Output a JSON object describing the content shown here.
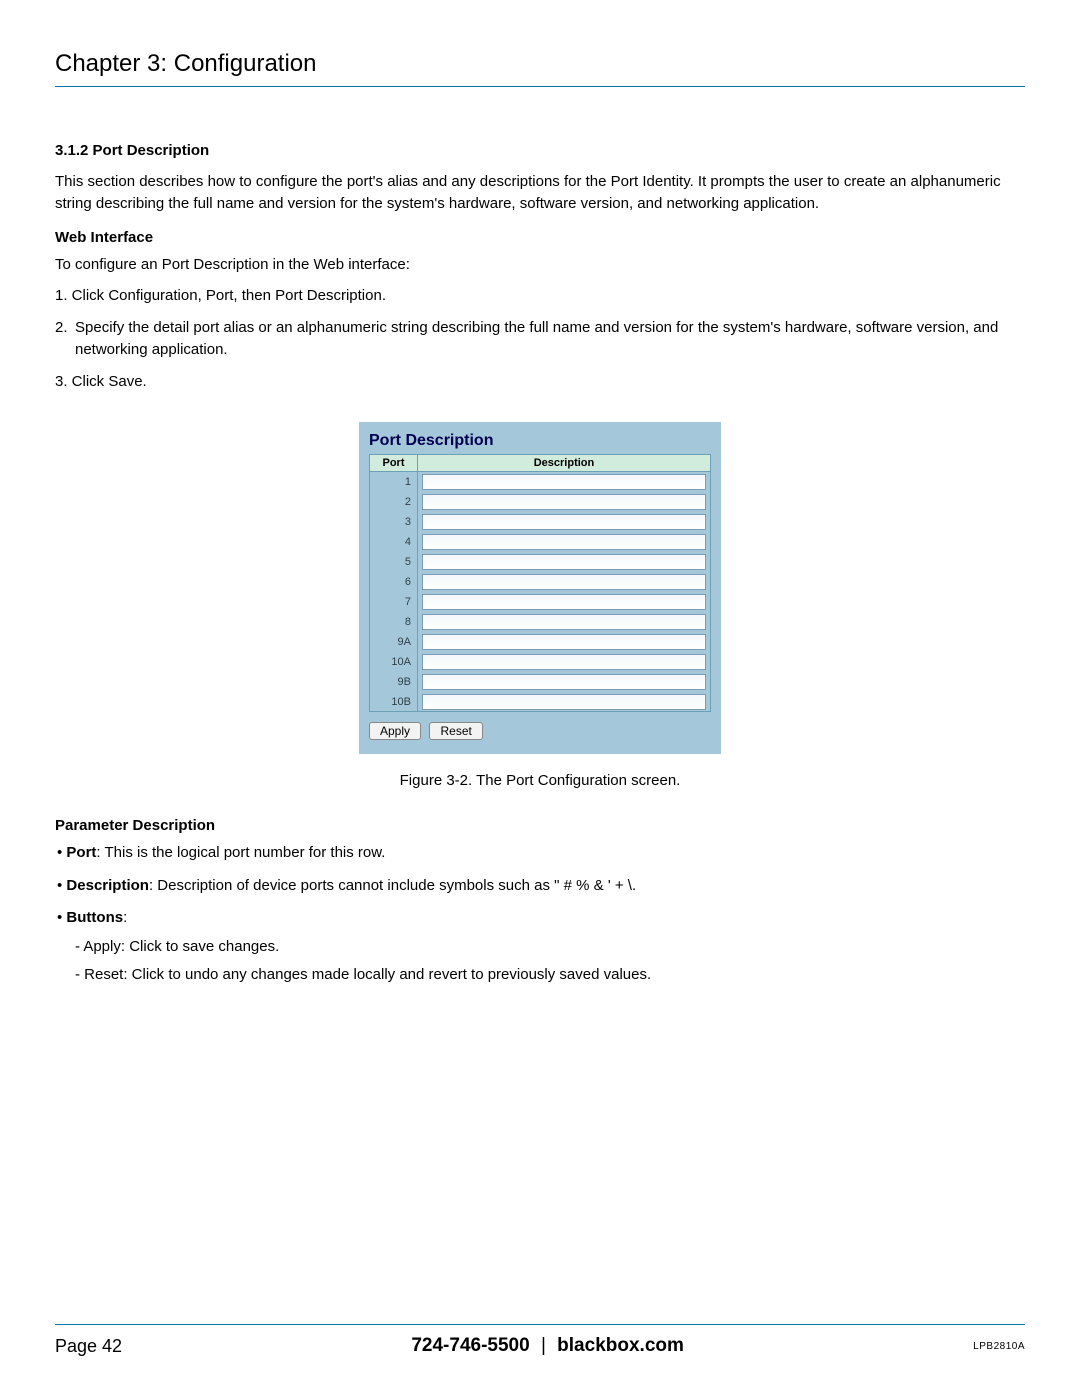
{
  "chapter": "Chapter 3: Configuration",
  "section": "3.1.2 Port Description",
  "intro": "This section describes how to configure the port's alias and any descriptions for the Port Identity. It prompts the user to create an alphanumeric string describing the full name and version for the system's hardware, software version, and networking application.",
  "web_heading": "Web Interface",
  "web_intro": "To configure an Port Description in the Web interface:",
  "steps": [
    "1. Click Configuration, Port, then Port Description.",
    "2. Specify the detail port alias or an alphanumeric string describing the full name and version for the system's hardware, software version, and networking application.",
    "3. Click Save."
  ],
  "panel": {
    "title": "Port Description",
    "col_port": "Port",
    "col_desc": "Description",
    "ports": [
      "1",
      "2",
      "3",
      "4",
      "5",
      "6",
      "7",
      "8",
      "9A",
      "10A",
      "9B",
      "10B"
    ],
    "apply": "Apply",
    "reset": "Reset"
  },
  "figure_caption": "Figure 3-2. The Port Configuration screen.",
  "param_heading": "Parameter Description",
  "params": {
    "port_label": "Port",
    "port_text": ": This is the logical port number for this row.",
    "desc_label": "Description",
    "desc_text": ": Description of device ports cannot include symbols such as \" # % & ' + \\.",
    "buttons_label": "Buttons",
    "buttons_colon": ":",
    "apply_text": "- Apply: Click to save changes.",
    "reset_text": "- Reset: Click to undo any changes made locally and revert to previously saved values."
  },
  "footer": {
    "page": "Page 42",
    "phone": "724-746-5500",
    "sep": "|",
    "site": "blackbox.com",
    "code": "LPB2810A"
  }
}
